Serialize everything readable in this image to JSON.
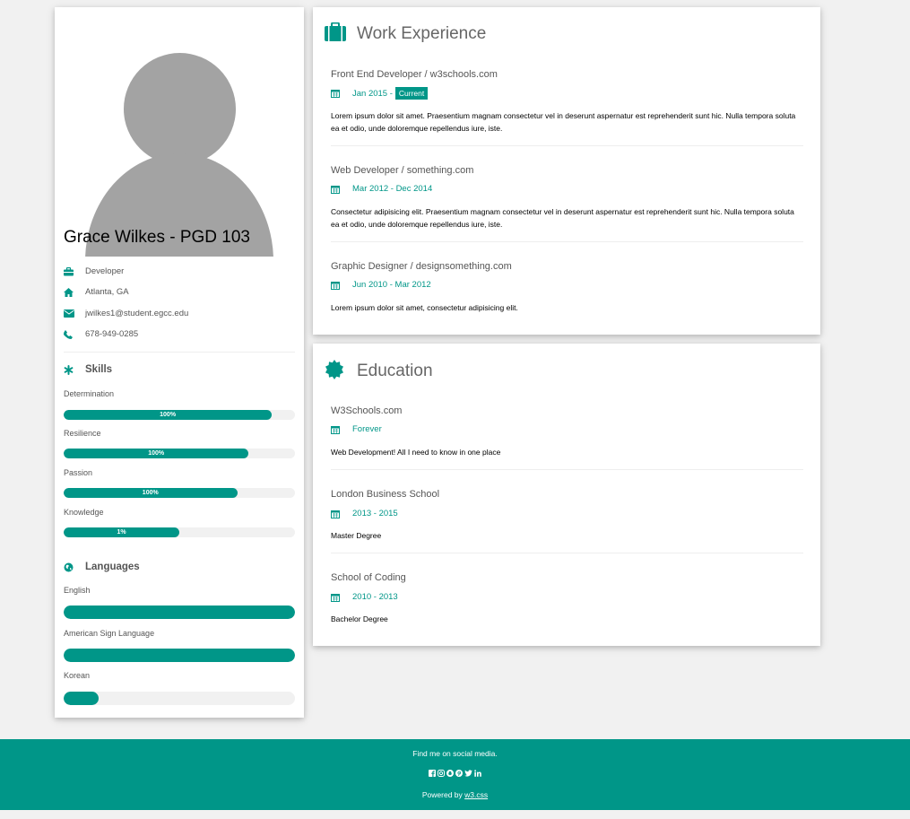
{
  "profile": {
    "name": "Grace Wilkes - PGD 103",
    "info": [
      {
        "icon": "briefcase-icon",
        "text": "Developer"
      },
      {
        "icon": "home-icon",
        "text": "Atlanta, GA"
      },
      {
        "icon": "envelope-icon",
        "text": "jwilkes1@student.egcc.edu"
      },
      {
        "icon": "phone-icon",
        "text": "678-949-0285"
      }
    ]
  },
  "skills": {
    "title": "Skills",
    "items": [
      {
        "label": "Determination",
        "value_text": "100%",
        "fill": 0.9
      },
      {
        "label": "Resilience",
        "value_text": "100%",
        "fill": 0.8
      },
      {
        "label": "Passion",
        "value_text": "100%",
        "fill": 0.75
      },
      {
        "label": "Knowledge",
        "value_text": "1%",
        "fill": 0.5
      }
    ]
  },
  "languages": {
    "title": "Languages",
    "items": [
      {
        "label": "English",
        "fill": 1.0
      },
      {
        "label": "American Sign Language",
        "fill": 1.0
      },
      {
        "label": "Korean",
        "fill": 0.15
      }
    ]
  },
  "work": {
    "title": "Work Experience",
    "entries": [
      {
        "title": "Front End Developer / w3schools.com",
        "date": "Jan 2015 -",
        "tag": "Current",
        "desc": "Lorem ipsum dolor sit amet. Praesentium magnam consectetur vel in deserunt aspernatur est reprehenderit sunt hic. Nulla tempora soluta ea et odio, unde doloremque repellendus iure, iste."
      },
      {
        "title": "Web Developer / something.com",
        "date": "Mar 2012 - Dec 2014",
        "desc": "Consectetur adipisicing elit. Praesentium magnam consectetur vel in deserunt aspernatur est reprehenderit sunt hic. Nulla tempora soluta ea et odio, unde doloremque repellendus iure, iste."
      },
      {
        "title": "Graphic Designer / designsomething.com",
        "date": "Jun 2010 - Mar 2012",
        "desc": "Lorem ipsum dolor sit amet, consectetur adipisicing elit."
      }
    ]
  },
  "education": {
    "title": "Education",
    "entries": [
      {
        "title": "W3Schools.com",
        "date": "Forever",
        "desc": "Web Development! All I need to know in one place"
      },
      {
        "title": "London Business School",
        "date": "2013 - 2015",
        "desc": "Master Degree"
      },
      {
        "title": "School of Coding",
        "date": "2010 - 2013",
        "desc": "Bachelor Degree"
      }
    ]
  },
  "footer": {
    "social_text": "Find me on social media.",
    "powered_prefix": "Powered by ",
    "powered_link": "w3.css"
  },
  "colors": {
    "accent": "#009688",
    "background": "#f1f1f1"
  }
}
